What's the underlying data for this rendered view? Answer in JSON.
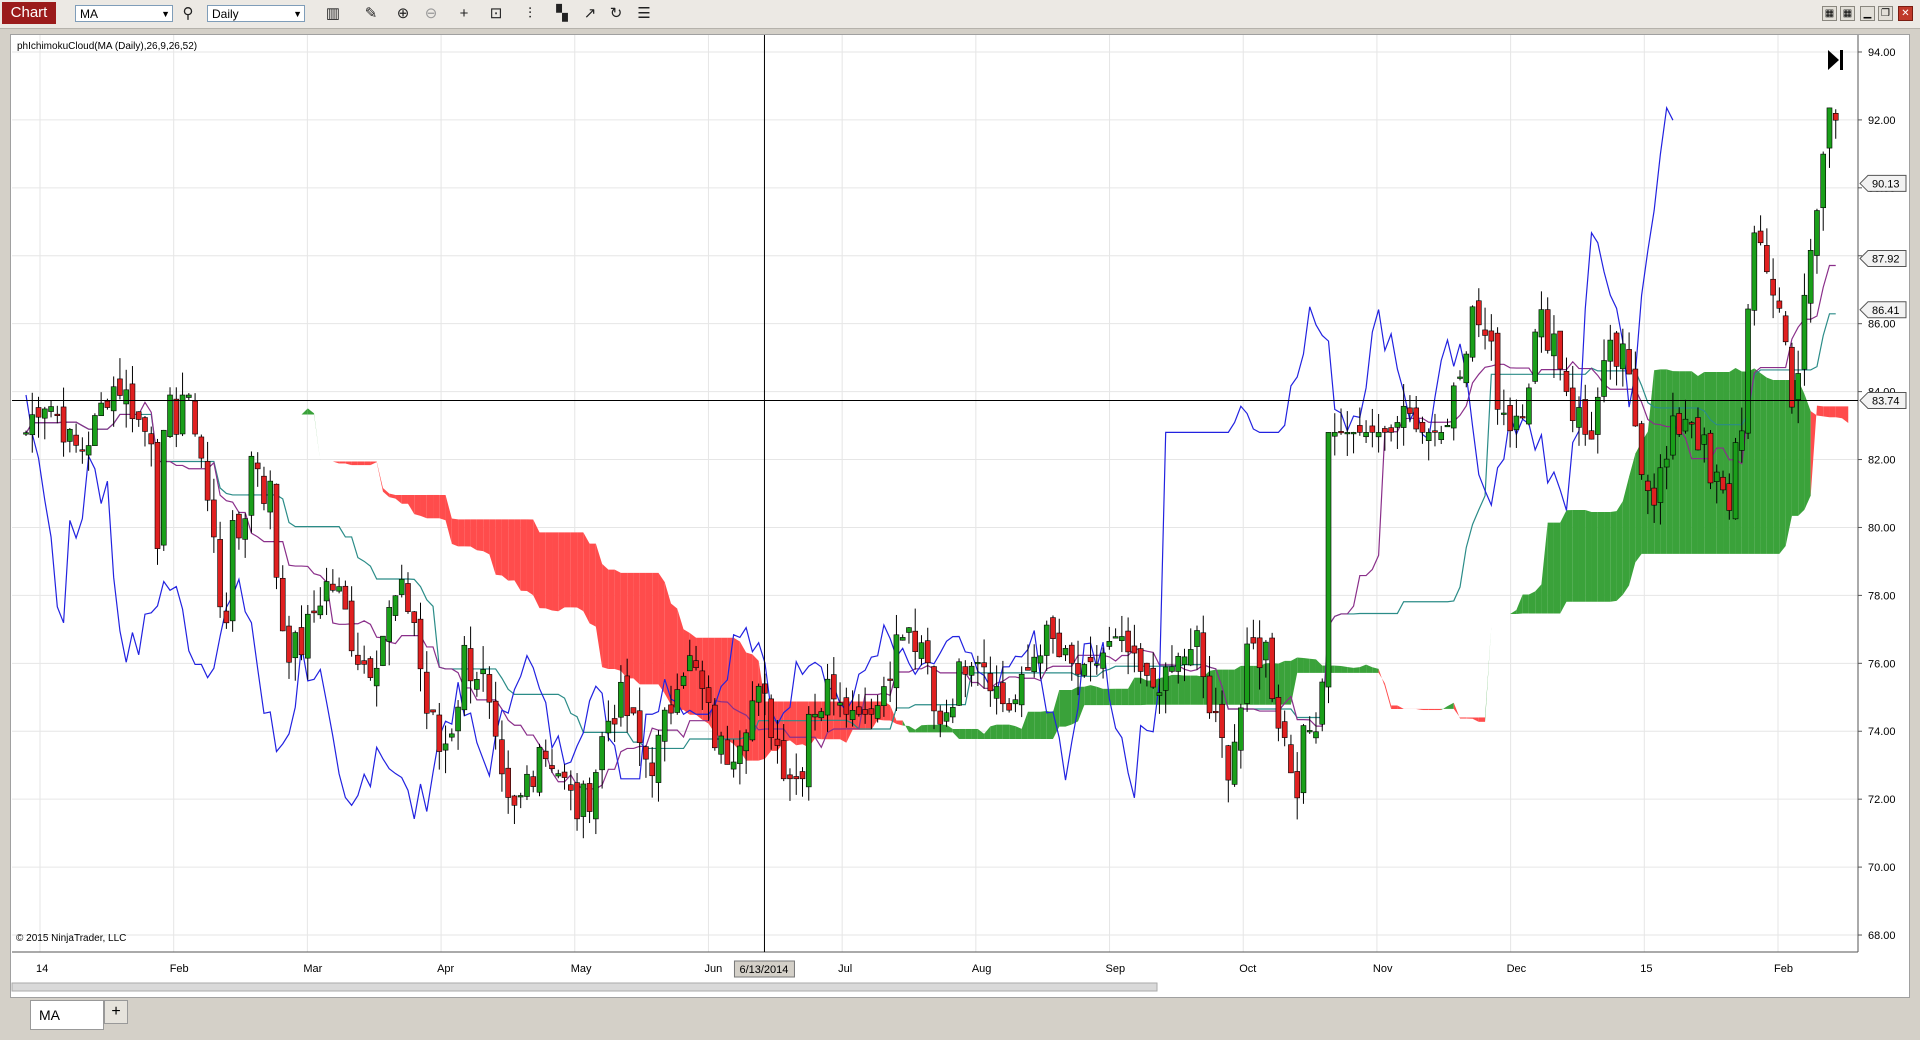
{
  "toolbar": {
    "chart_tab_label": "Chart",
    "instrument": "MA",
    "interval": "Daily",
    "icons": [
      "bars-style-icon",
      "draw-pencil-icon",
      "zoom-in-icon",
      "zoom-out-icon",
      "crosshair-icon",
      "data-box-icon",
      "indicators-icon",
      "strategies-icon",
      "drawing-tools-icon",
      "reload-icon",
      "properties-icon"
    ]
  },
  "window_controls": [
    "grid-icon",
    "grid-icon",
    "minimize-icon",
    "restore-icon",
    "close-icon"
  ],
  "indicator_label": "phIchimokuCloud(MA (Daily),26,9,26,52)",
  "copyright": "© 2015 NinjaTrader, LLC",
  "price_axis_labels": [
    "94.00",
    "92.00",
    "90.00",
    "88.00",
    "86.00",
    "84.00",
    "82.00",
    "80.00",
    "78.00",
    "76.00",
    "74.00",
    "72.00",
    "70.00",
    "68.00"
  ],
  "price_markers": [
    "90.13",
    "87.92",
    "86.41",
    "83.74"
  ],
  "time_axis_labels": [
    "14",
    "Feb",
    "Mar",
    "Apr",
    "May",
    "Jun",
    "Jul",
    "Aug",
    "Sep",
    "Oct",
    "Nov",
    "Dec",
    "15",
    "Feb"
  ],
  "crosshair_date": "6/13/2014",
  "bottom_tabs": {
    "active": "MA",
    "add_label": "+"
  },
  "colors": {
    "up": "#1a9f1a",
    "down": "#e02020",
    "kijun": "#2b8c88",
    "tenkan": "#8a2f8a",
    "chikou": "#2222e0",
    "cloud_up": "#3aa23a",
    "cloud_down": "#ff4c4c"
  },
  "chart_data": {
    "type": "candlestick",
    "ylim": [
      67.5,
      94.5
    ],
    "months": [
      {
        "label": "Jan 2014",
        "first": 82.8,
        "last": 83.6,
        "hi": 84.7,
        "lo": 81.0
      },
      {
        "label": "Feb",
        "first": 83.0,
        "last": 78.7,
        "hi": 83.9,
        "lo": 72.0
      },
      {
        "label": "Mar",
        "first": 77.5,
        "last": 76.8,
        "hi": 79.6,
        "lo": 74.8
      },
      {
        "label": "Apr",
        "first": 76.2,
        "last": 72.0,
        "hi": 77.6,
        "lo": 68.8
      },
      {
        "label": "May",
        "first": 72.2,
        "last": 74.8,
        "hi": 76.0,
        "lo": 70.7
      },
      {
        "label": "Jun",
        "first": 75.2,
        "last": 73.2,
        "hi": 77.3,
        "lo": 72.6
      },
      {
        "label": "Jul",
        "first": 73.8,
        "last": 76.5,
        "hi": 78.9,
        "lo": 74.5
      },
      {
        "label": "Aug",
        "first": 75.3,
        "last": 75.9,
        "hi": 77.7,
        "lo": 73.6
      },
      {
        "label": "Sep",
        "first": 76.3,
        "last": 75.7,
        "hi": 77.2,
        "lo": 74.7
      },
      {
        "label": "Oct",
        "first": 75.2,
        "last": 74.5,
        "hi": 77.6,
        "lo": 69.9
      },
      {
        "label": "Nov",
        "first": 81.5,
        "last": 83.5,
        "hi": 85.4,
        "lo": 82.8
      },
      {
        "label": "Dec",
        "first": 84.8,
        "last": 84.5,
        "hi": 88.3,
        "lo": 82.0
      },
      {
        "label": "Jan 2015",
        "first": 84.2,
        "last": 81.5,
        "hi": 86.6,
        "lo": 80.0
      },
      {
        "label": "Feb",
        "first": 82.5,
        "last": 90.13,
        "hi": 92.8,
        "lo": 80.5
      }
    ]
  }
}
